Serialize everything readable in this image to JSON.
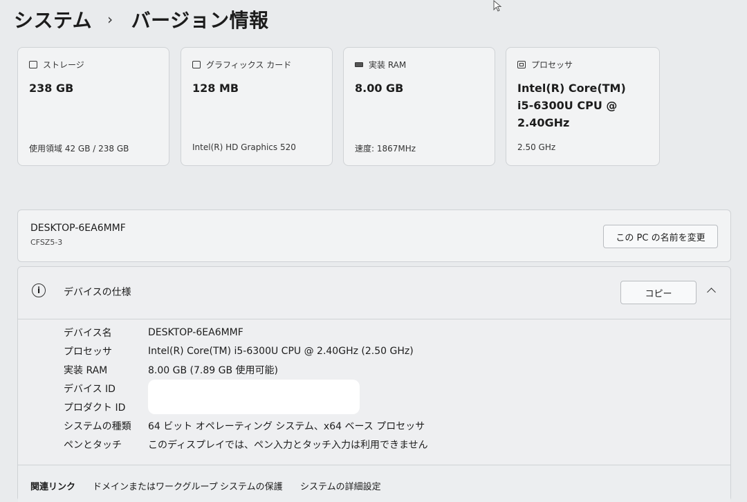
{
  "breadcrumb": {
    "parent": "システム",
    "separator": "›",
    "current": "バージョン情報"
  },
  "cards": [
    {
      "icon": "storage-icon",
      "title": "ストレージ",
      "value": "238 GB",
      "sub": "使用領域 42 GB / 238 GB"
    },
    {
      "icon": "graphics-card-icon",
      "title": "グラフィックス カード",
      "value": "128 MB",
      "sub": "Intel(R) HD Graphics 520"
    },
    {
      "icon": "ram-icon",
      "title": "実装 RAM",
      "value": "8.00 GB",
      "sub": "速度: 1867MHz"
    },
    {
      "icon": "processor-icon",
      "title": "プロセッサ",
      "value": "Intel(R) Core(TM) i5-6300U CPU @ 2.40GHz",
      "sub": "2.50 GHz"
    }
  ],
  "pc": {
    "name": "DESKTOP-6EA6MMF",
    "model": "CFSZ5-3",
    "rename_label": "この PC の名前を変更"
  },
  "spec": {
    "title": "デバイスの仕様",
    "copy_label": "コピー",
    "rows": [
      {
        "label": "デバイス名",
        "value": "DESKTOP-6EA6MMF"
      },
      {
        "label": "プロセッサ",
        "value": "Intel(R) Core(TM) i5-6300U CPU @ 2.40GHz (2.50 GHz)"
      },
      {
        "label": "実装 RAM",
        "value": "8.00 GB (7.89 GB 使用可能)"
      },
      {
        "label": "デバイス ID",
        "value": ""
      },
      {
        "label": "プロダクト ID",
        "value": ""
      },
      {
        "label": "システムの種類",
        "value": "64 ビット オペレーティング システム、x64 ベース プロセッサ"
      },
      {
        "label": "ペンとタッチ",
        "value": "このディスプレイでは、ペン入力とタッチ入力は利用できません"
      }
    ]
  },
  "related_links": {
    "label": "関連リンク",
    "items": [
      "ドメインまたはワークグループ",
      "システムの保護",
      "システムの詳細設定"
    ]
  }
}
